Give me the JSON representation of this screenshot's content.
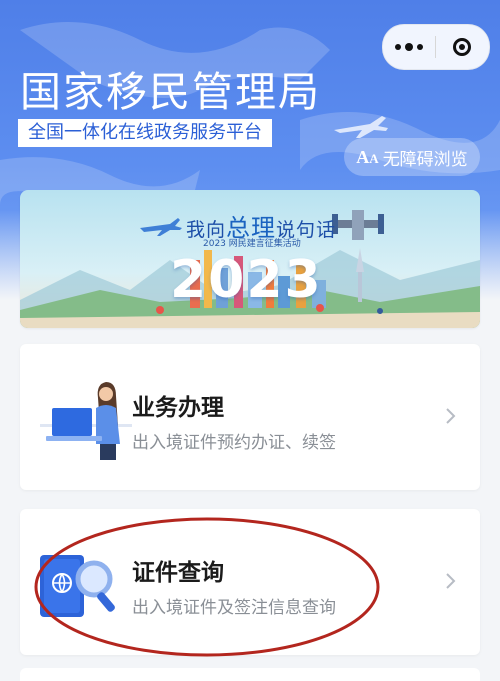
{
  "header": {
    "agency_title": "国家移民管理局",
    "agency_subtitle": "全国一体化在线政务服务平台",
    "accessibility_label": "无障碍浏览",
    "accessibility_icon_text": "A",
    "accessibility_icon_small": "A"
  },
  "capsule": {
    "more_icon": "more-dots-icon",
    "close_icon": "target-close-icon"
  },
  "banner": {
    "title_part1": "我向",
    "title_big1": "总",
    "title_big2": "理",
    "title_part2": "说句话",
    "caption": "2023 网民建言征集活动",
    "year": "2023"
  },
  "services": [
    {
      "title": "业务办理",
      "description": "出入境证件预约办证、续签",
      "icon": "person-laptop-icon"
    },
    {
      "title": "证件查询",
      "description": "出入境证件及签注信息查询",
      "icon": "passport-magnifier-icon"
    }
  ],
  "colors": {
    "header_blue": "#4f7fe8",
    "subtitle_blue": "#2b5fd6",
    "annotation_red": "#b3261e"
  }
}
